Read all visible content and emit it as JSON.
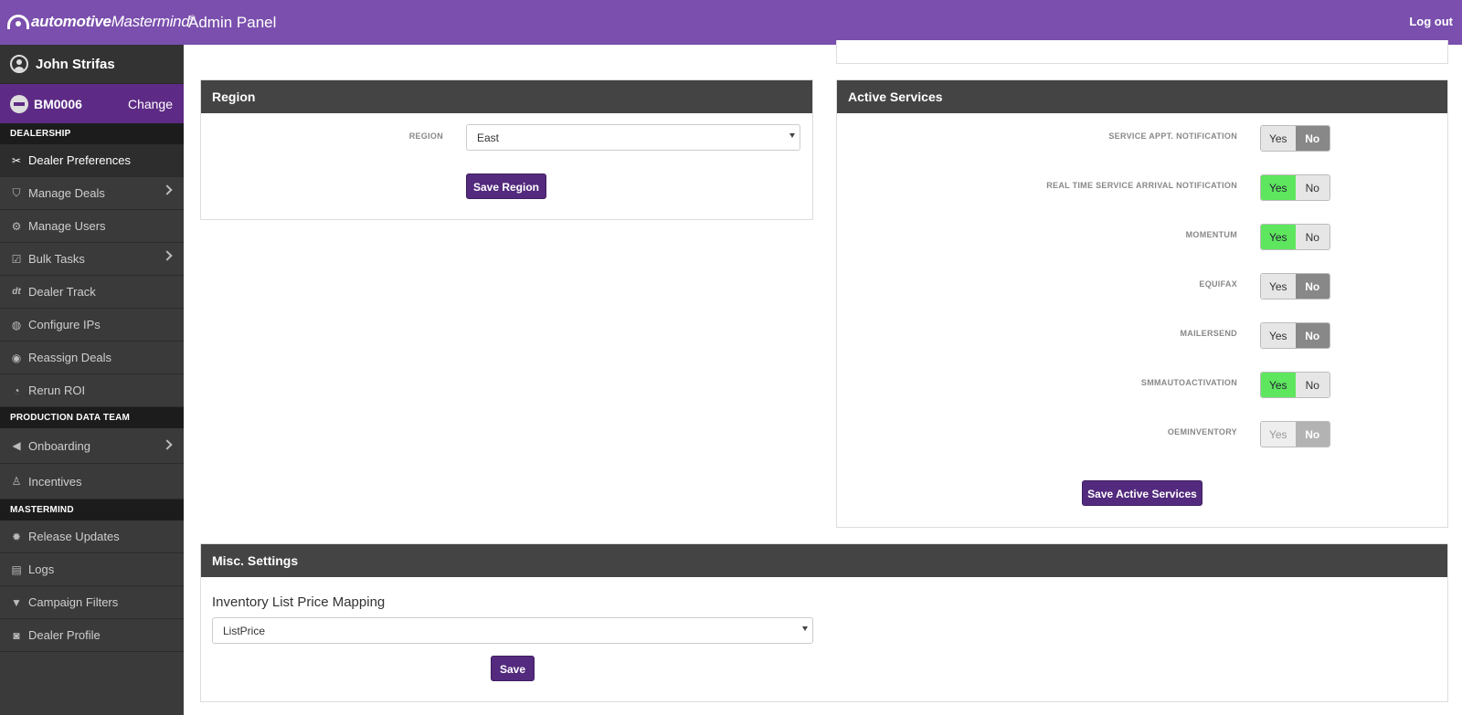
{
  "header": {
    "brand_bold": "automotive",
    "brand_italic": "Mastermind",
    "brand_mark": "®",
    "title": "Admin Panel",
    "logout": "Log out"
  },
  "sidebar": {
    "user_name": "John Strifas",
    "dealer_code": "BM0006",
    "change_label": "Change",
    "sections": [
      {
        "title": "DEALERSHIP"
      },
      {
        "title": "PRODUCTION DATA TEAM"
      },
      {
        "title": "MASTERMIND"
      }
    ],
    "items": [
      {
        "label": "Dealer Preferences",
        "icon": "wrench-icon"
      },
      {
        "label": "Manage Deals",
        "icon": "shield-icon"
      },
      {
        "label": "Manage Users",
        "icon": "gear-icon"
      },
      {
        "label": "Bulk Tasks",
        "icon": "checklist-icon"
      },
      {
        "label": "Dealer Track",
        "icon": "dt-icon"
      },
      {
        "label": "Configure IPs",
        "icon": "globe-icon"
      },
      {
        "label": "Reassign Deals",
        "icon": "user-circle-icon"
      },
      {
        "label": "Rerun ROI",
        "icon": "pie-icon"
      },
      {
        "label": "Onboarding",
        "icon": "megaphone-icon"
      },
      {
        "label": "Incentives",
        "icon": "moneybag-icon"
      },
      {
        "label": "Release Updates",
        "icon": "cog-icon"
      },
      {
        "label": "Logs",
        "icon": "stack-icon"
      },
      {
        "label": "Campaign Filters",
        "icon": "filter-icon"
      },
      {
        "label": "Dealer Profile",
        "icon": "car-icon"
      }
    ]
  },
  "region": {
    "title": "Region",
    "label": "REGION",
    "value": "East",
    "save": "Save Region"
  },
  "services": {
    "title": "Active Services",
    "items": [
      {
        "label": "SERVICE APPT. NOTIFICATION",
        "state": "No"
      },
      {
        "label": "REAL TIME SERVICE ARRIVAL NOTIFICATION",
        "state": "Yes"
      },
      {
        "label": "MOMENTUM",
        "state": "Yes"
      },
      {
        "label": "EQUIFAX",
        "state": "No"
      },
      {
        "label": "MAILERSEND",
        "state": "No"
      },
      {
        "label": "SMMAUTOACTIVATION",
        "state": "Yes"
      },
      {
        "label": "OEMINVENTORY",
        "state": "No",
        "disabled": true
      }
    ],
    "yes": "Yes",
    "no": "No",
    "save": "Save Active Services"
  },
  "misc": {
    "title": "Misc. Settings",
    "field_label": "Inventory List Price Mapping",
    "value": "ListPrice",
    "save": "Save"
  },
  "colors": {
    "header": "#7a4fad",
    "dealer_bar": "#5d2b85",
    "button": "#532a7d",
    "toggle_yes": "#5ee65e"
  }
}
